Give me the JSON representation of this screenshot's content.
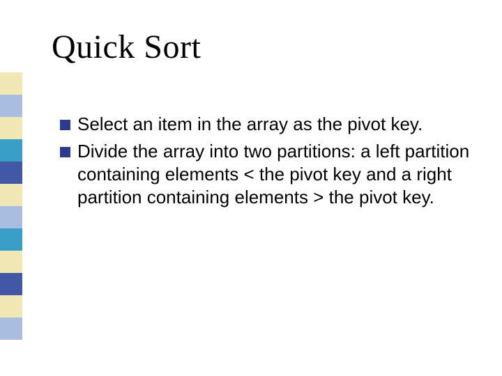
{
  "title": "Quick Sort",
  "bullets": [
    {
      "text": "Select an item in the array as the  pivot key."
    },
    {
      "text": "Divide the array into two partitions: a left partition containing elements < the pivot key and a right partition containing elements > the pivot key."
    }
  ],
  "stripes": [
    "#f0e7b4",
    "#a8bde0",
    "#f0e7b4",
    "#3a9fc6",
    "#4258a6",
    "#f0e7b4",
    "#a8bde0",
    "#3a9fc6",
    "#f0e7b4",
    "#4258a6",
    "#f0e7b4",
    "#a8bde0"
  ]
}
